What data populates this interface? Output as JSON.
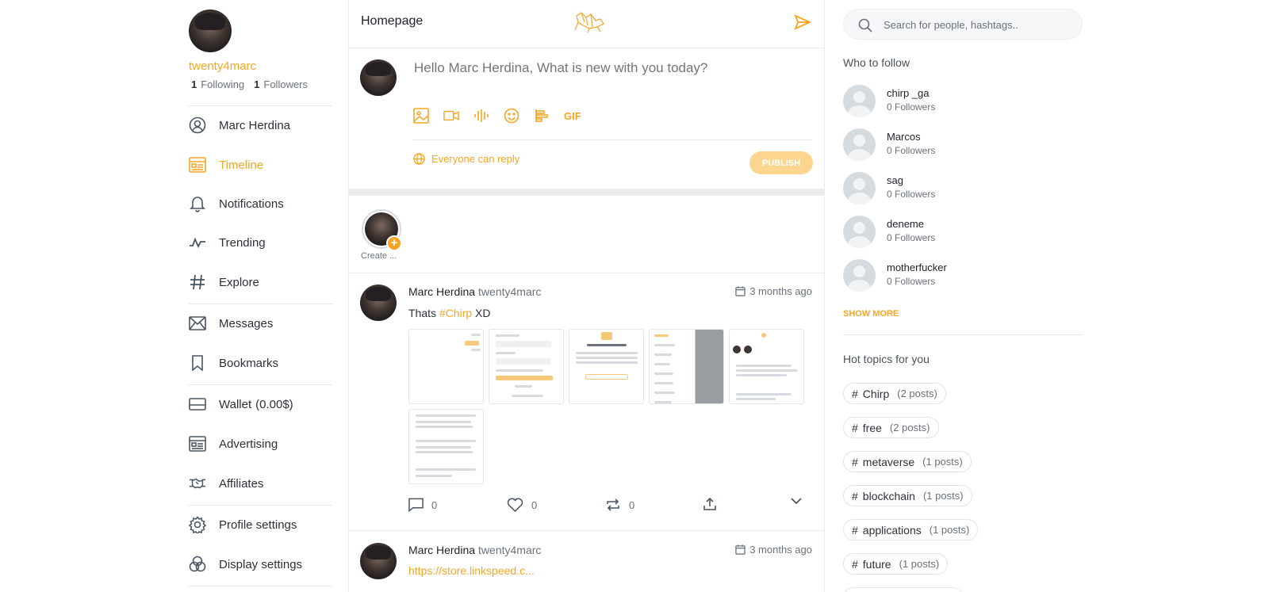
{
  "profile": {
    "username": "twenty4marc",
    "following_count": "1",
    "following_label": "Following",
    "followers_count": "1",
    "followers_label": "Followers"
  },
  "nav": {
    "items": [
      {
        "label": "Marc Herdina"
      },
      {
        "label": "Timeline"
      },
      {
        "label": "Notifications"
      },
      {
        "label": "Trending"
      },
      {
        "label": "Explore"
      },
      {
        "label": "Messages"
      },
      {
        "label": "Bookmarks"
      },
      {
        "label": "Wallet",
        "extra": "(0.00$)"
      },
      {
        "label": "Advertising"
      },
      {
        "label": "Affiliates"
      },
      {
        "label": "Profile settings"
      },
      {
        "label": "Display settings"
      }
    ],
    "active": "Timeline"
  },
  "header": {
    "title": "Homepage"
  },
  "composer": {
    "placeholder": "Hello Marc Herdina, What is new with you today?",
    "gif_label": "GIF",
    "reply_setting": "Everyone can reply",
    "publish_label": "PUBLISH"
  },
  "stories": {
    "create_label": "Create ..."
  },
  "posts": [
    {
      "author": "Marc Herdina",
      "handle": "twenty4marc",
      "time": "3 months ago",
      "text_before": "Thats ",
      "hashtag": "#Chirp",
      "text_after": " XD",
      "reply_count": "0",
      "like_count": "0",
      "repost_count": "0"
    },
    {
      "author": "Marc Herdina",
      "handle": "twenty4marc",
      "time": "3 months ago",
      "link": "https://store.linkspeed.c..."
    }
  ],
  "search": {
    "placeholder": "Search for people, hashtags.."
  },
  "who_to_follow": {
    "title": "Who to follow",
    "users": [
      {
        "name": "chirp _ga",
        "followers": "0 Followers"
      },
      {
        "name": "Marcos",
        "followers": "0 Followers"
      },
      {
        "name": "sag",
        "followers": "0 Followers"
      },
      {
        "name": "deneme",
        "followers": "0 Followers"
      },
      {
        "name": "motherfucker",
        "followers": "0 Followers"
      }
    ],
    "show_more": "SHOW MORE"
  },
  "hot_topics": {
    "title": "Hot topics for you",
    "topics": [
      {
        "tag": "Chirp",
        "count": "(2 posts)"
      },
      {
        "tag": "free",
        "count": "(2 posts)"
      },
      {
        "tag": "metaverse",
        "count": "(1 posts)"
      },
      {
        "tag": "blockchain",
        "count": "(1 posts)"
      },
      {
        "tag": "applications",
        "count": "(1 posts)"
      },
      {
        "tag": "future",
        "count": "(1 posts)"
      }
    ]
  },
  "colors": {
    "accent": "#f5a623",
    "publish_disabled": "#fcd58f",
    "wallet": "#1e8a2e"
  }
}
